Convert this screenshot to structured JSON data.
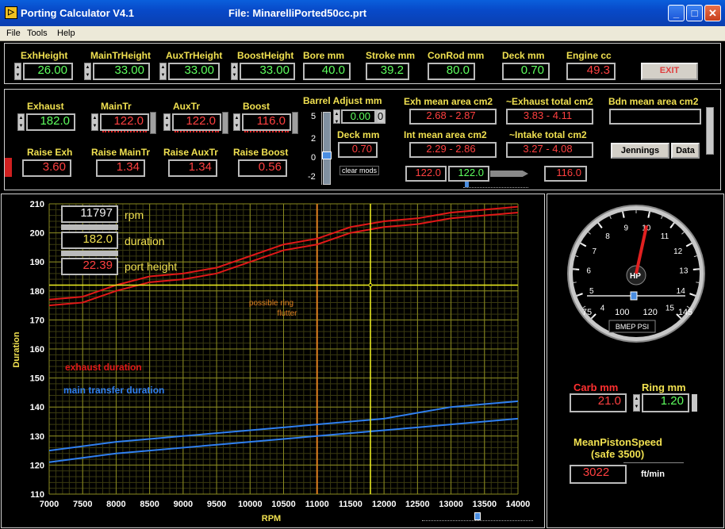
{
  "window": {
    "title": "Porting Calculator V4.1",
    "file_label": "File: MinarelliPorted50cc.prt",
    "minimize": "_",
    "maximize": "□",
    "close": "✕"
  },
  "menu": [
    "File",
    "Tools",
    "Help"
  ],
  "top_fields": [
    {
      "label": "ExhHeight",
      "value": "26.00",
      "color": "g"
    },
    {
      "label": "MainTrHeight",
      "value": "33.00",
      "color": "g"
    },
    {
      "label": "AuxTrHeight",
      "value": "33.00",
      "color": "g"
    },
    {
      "label": "BoostHeight",
      "value": "33.00",
      "color": "g"
    },
    {
      "label": "Bore mm",
      "value": "40.0",
      "color": "g"
    },
    {
      "label": "Stroke mm",
      "value": "39.2",
      "color": "g"
    },
    {
      "label": "ConRod mm",
      "value": "80.0",
      "color": "g"
    },
    {
      "label": "Deck mm",
      "value": "0.70",
      "color": "g"
    },
    {
      "label": "Engine cc",
      "value": "49.3",
      "color": "r"
    }
  ],
  "exit_label": "EXIT",
  "durations": [
    {
      "label": "Exhaust",
      "value": "182.0",
      "color": "g"
    },
    {
      "label": "MainTr",
      "value": "122.0",
      "color": "r"
    },
    {
      "label": "AuxTr",
      "value": "122.0",
      "color": "r"
    },
    {
      "label": "Boost",
      "value": "116.0",
      "color": "r"
    }
  ],
  "raises": [
    {
      "label": "Raise Exh",
      "value": "3.60"
    },
    {
      "label": "Raise MainTr",
      "value": "1.34"
    },
    {
      "label": "Raise AuxTr",
      "value": "1.34"
    },
    {
      "label": "Raise Boost",
      "value": "0.56"
    }
  ],
  "barrel": {
    "label": "Barrel Adjust mm",
    "value": "0.00",
    "offset_digit": "0",
    "scale": [
      "5",
      "2",
      "0",
      "-2"
    ],
    "deck_label": "Deck mm",
    "deck_value": "0.70",
    "clear_label": "clear mods"
  },
  "areas": {
    "exh_mean_label": "Exh mean area cm2",
    "exh_mean_value": "2.68 - 2.87",
    "exh_total_label": "~Exhaust total cm2",
    "exh_total_value": "3.83 - 4.11",
    "bdn_label": "Bdn mean area cm2",
    "int_mean_label": "Int mean area cm2",
    "int_mean_value": "2.29 - 2.86",
    "int_total_label": "~Intake total cm2",
    "int_total_value": "3.27 - 4.08"
  },
  "buttons": {
    "jennings": "Jennings",
    "data": "Data"
  },
  "mini_values": {
    "a": "122.0",
    "b": "122.0",
    "c": "116.0"
  },
  "readouts": {
    "rpm_value": "11797",
    "rpm_label": "rpm",
    "duration_value": "182.0",
    "duration_label": "duration",
    "height_value": "22.39",
    "height_label": "port height"
  },
  "annotations": {
    "flutter_line1": "possible ring",
    "flutter_line2": "flutter",
    "exhaust_label": "exhaust duration",
    "transfer_label": "main transfer duration"
  },
  "colors": {
    "exhaust": "#e01818",
    "transfer": "#2f7ff0",
    "grid_major": "#8a8a20",
    "grid_minor": "#3a3a10",
    "cursor": "#f0f020",
    "flutter": "#e08020"
  },
  "chart_data": {
    "type": "line",
    "xlabel": "RPM",
    "ylabel": "Duration",
    "xlim": [
      7000,
      14000
    ],
    "ylim": [
      110,
      210
    ],
    "x_ticks": [
      7000,
      7500,
      8000,
      8500,
      9000,
      9500,
      10000,
      10500,
      11000,
      11500,
      12000,
      12500,
      13000,
      13500,
      14000
    ],
    "y_ticks": [
      110,
      120,
      130,
      140,
      150,
      160,
      170,
      180,
      190,
      200,
      210
    ],
    "x": [
      7000,
      7500,
      8000,
      8500,
      9000,
      9500,
      10000,
      10500,
      11000,
      11500,
      12000,
      12500,
      13000,
      13500,
      14000
    ],
    "series": [
      {
        "values": [
          177,
          178,
          182,
          185,
          186,
          188,
          192,
          196,
          198,
          202,
          204,
          205,
          207,
          208,
          209
        ]
      },
      {
        "values": [
          175,
          176,
          180,
          183,
          184,
          186,
          190,
          194,
          196,
          200,
          202,
          203,
          205,
          206,
          207
        ]
      },
      {
        "values": [
          125,
          126.5,
          128,
          129,
          130,
          131,
          132,
          133,
          134,
          135,
          136,
          138,
          140,
          141,
          142
        ]
      },
      {
        "values": [
          121,
          122.5,
          124,
          125,
          126,
          127,
          128,
          129,
          130,
          131,
          132,
          133,
          134,
          135,
          136
        ]
      }
    ],
    "flutter_rpm": 11000,
    "cursor_rpm": 11797,
    "cursor_duration": 182.0
  },
  "gauge": {
    "ticks": [
      "4",
      "5",
      "6",
      "7",
      "8",
      "9",
      "10",
      "11",
      "12",
      "13",
      "14",
      "15"
    ],
    "needle_value": 10,
    "unit": "HP",
    "bmep_ticks": [
      "75",
      "100",
      "120",
      "145"
    ],
    "bmep_label": "BMEP PSI"
  },
  "carb": {
    "label": "Carb mm",
    "value": "21.0"
  },
  "ring": {
    "label": "Ring mm",
    "value": "1.20"
  },
  "piston": {
    "label1": "MeanPistonSpeed",
    "label2": "(safe 3500)",
    "value": "3022",
    "unit": "ft/min"
  }
}
